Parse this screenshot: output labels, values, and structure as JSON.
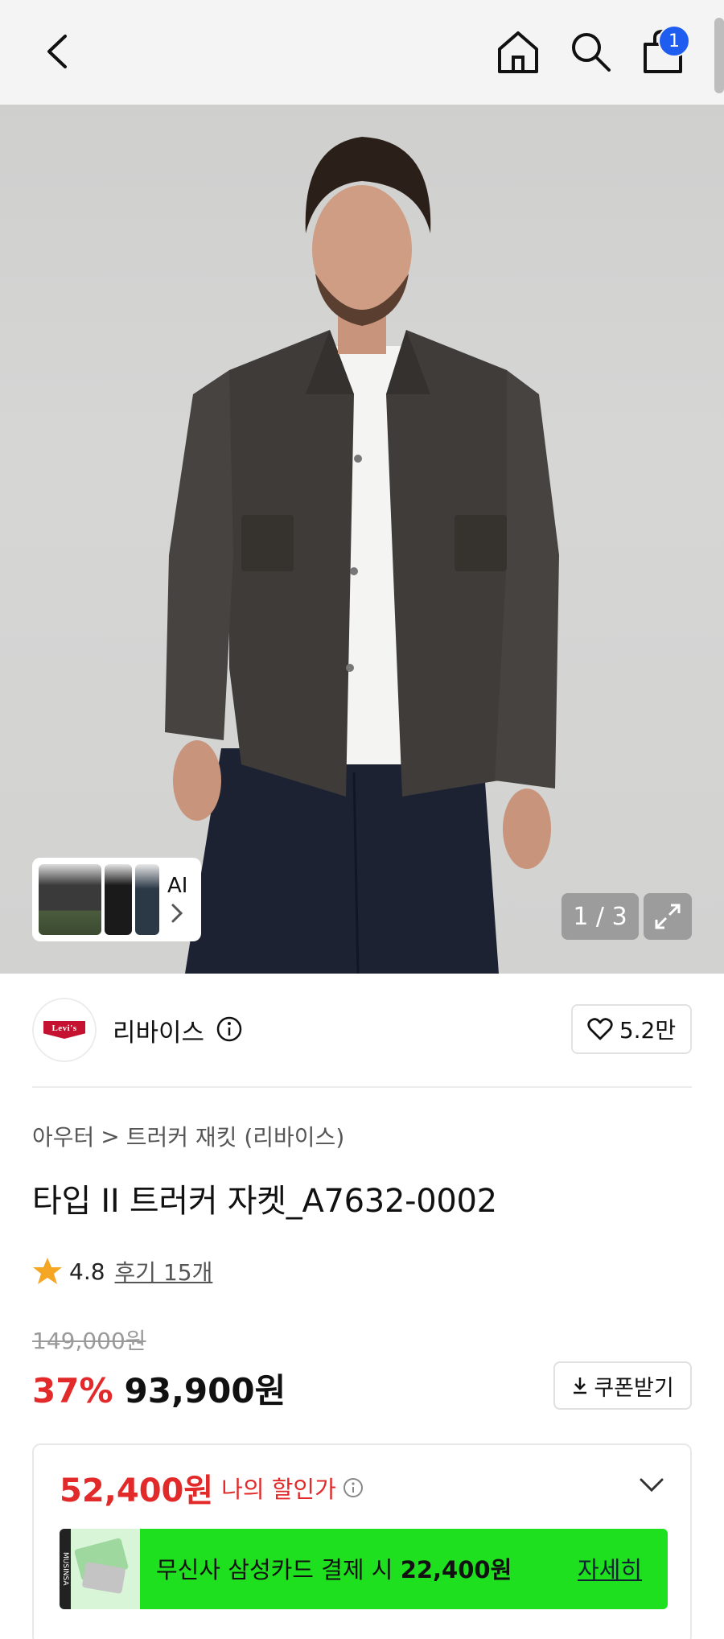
{
  "header": {
    "cart_count": "1"
  },
  "gallery": {
    "counter": "1 / 3",
    "ai_label": "AI"
  },
  "brand": {
    "logo_text": "Levi's",
    "name": "리바이스",
    "likes": "5.2만"
  },
  "breadcrumb": {
    "category": "아우터",
    "separator": ">",
    "subcategory": "트러커 재킷 (리바이스)"
  },
  "product": {
    "title": "타입 II 트러커 자켓_A7632-0002",
    "rating": "4.8",
    "reviews": "후기 15개",
    "original_price": "149,000원",
    "discount": "37%",
    "price": "93,900원",
    "coupon_label": "쿠폰받기"
  },
  "my_discount": {
    "price": "52,400원",
    "label": "나의 할인가",
    "banner_text": "무신사 삼성카드 결제 시",
    "banner_amount": "22,400원",
    "banner_link": "자세히",
    "banner_logo": "MUSINSA"
  },
  "colors": {
    "accent_red": "#e32a2a",
    "badge_blue": "#1f5cf0",
    "banner_green": "#1fe01f"
  }
}
